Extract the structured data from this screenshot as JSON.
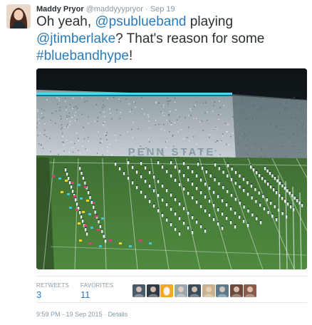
{
  "author": {
    "name": "Maddy Pryor",
    "handle": "@maddyyypryor",
    "separator": " · ",
    "time": "Sep 19"
  },
  "tweet": {
    "part1": "Oh yeah, ",
    "mention1": "@psublueband",
    "part2": " playing ",
    "mention2": "@jtimberlake",
    "part3": "? That's reason for some ",
    "hashtag": "#bluebandhype",
    "part4": "!"
  },
  "media": {
    "stadium_banner": "PENN STATE"
  },
  "stats": {
    "retweets_label": "RETWEETS",
    "retweets_value": "3",
    "favorites_label": "FAVORITES",
    "favorites_value": "11"
  },
  "favoriters": [
    {
      "icon": "user-avatar-icon",
      "color": "#4a5a6a"
    },
    {
      "icon": "user-avatar-icon",
      "color": "#2f3a45"
    },
    {
      "icon": "default-egg-icon",
      "color": "#f5a623"
    },
    {
      "icon": "user-avatar-icon",
      "color": "#9aa7b1"
    },
    {
      "icon": "user-avatar-icon",
      "color": "#3b4b5a"
    },
    {
      "icon": "user-avatar-icon",
      "color": "#c9b28f"
    },
    {
      "icon": "user-avatar-icon",
      "color": "#5c7a8c"
    },
    {
      "icon": "user-avatar-icon",
      "color": "#6b4a3a"
    },
    {
      "icon": "user-avatar-icon",
      "color": "#8a5a4a"
    }
  ],
  "footer": {
    "timestamp": "9:59 PM - 19 Sep 2015",
    "separator": " · ",
    "details": "Details"
  },
  "colors": {
    "link": "#2b7bb9",
    "muted": "#8899a6",
    "text": "#292f33",
    "field": "#3f7a36"
  }
}
